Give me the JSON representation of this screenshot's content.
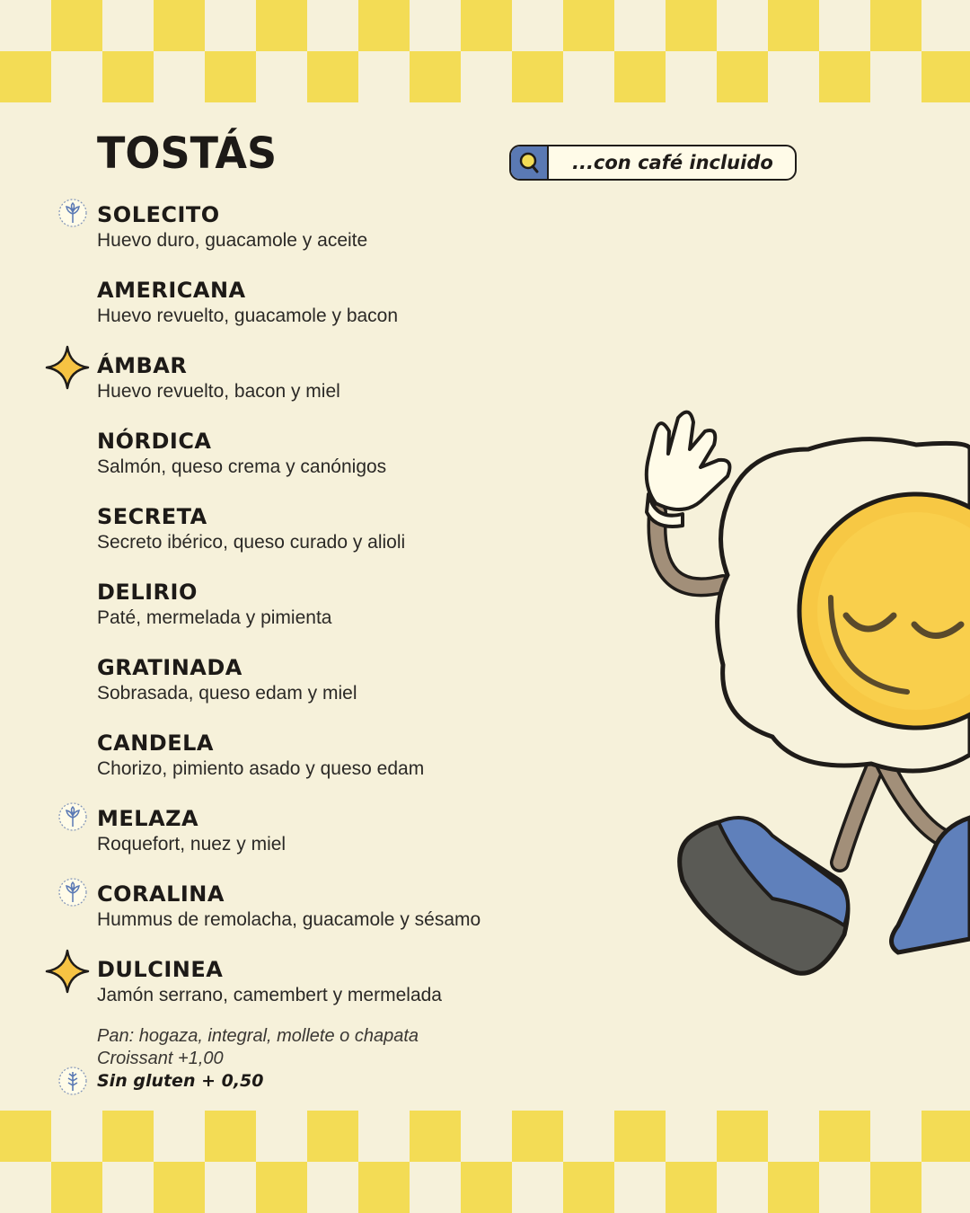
{
  "title": "TOSTÁS",
  "search": {
    "text": "...con café incluido",
    "icon": "magnifier-icon"
  },
  "items": [
    {
      "name": "SOLECITO",
      "desc": "Huevo duro, guacamole y aceite",
      "badge": "vegetarian-icon"
    },
    {
      "name": "AMERICANA",
      "desc": "Huevo revuelto, guacamole y bacon",
      "badge": ""
    },
    {
      "name": "ÁMBAR",
      "desc": "Huevo revuelto, bacon y miel",
      "badge": "star-icon"
    },
    {
      "name": "NÓRDICA",
      "desc": "Salmón, queso crema y canónigos",
      "badge": ""
    },
    {
      "name": "SECRETA",
      "desc": "Secreto ibérico, queso curado y alioli",
      "badge": ""
    },
    {
      "name": "DELIRIO",
      "desc": "Paté, mermelada y pimienta",
      "badge": ""
    },
    {
      "name": "GRATINADA",
      "desc": "Sobrasada, queso edam y miel",
      "badge": ""
    },
    {
      "name": "CANDELA",
      "desc": "Chorizo, pimiento asado y queso edam",
      "badge": ""
    },
    {
      "name": "MELAZA",
      "desc": "Roquefort, nuez y miel",
      "badge": "vegetarian-icon"
    },
    {
      "name": "CORALINA",
      "desc": "Hummus de remolacha, guacamole y sésamo",
      "badge": "vegetarian-icon"
    },
    {
      "name": "DULCINEA",
      "desc": "Jamón serrano, camembert y mermelada",
      "badge": "star-icon"
    }
  ],
  "notes": {
    "bread": "Pan: hogaza, integral, mollete o chapata",
    "croissant": "Croissant +1,00",
    "gluten_free": "Sin gluten + 0,50",
    "gluten_free_icon": "gluten-free-icon"
  },
  "colors": {
    "background": "#f6f1da",
    "checker": "#f3dc55",
    "star": "#f6c343",
    "search_icon_bg": "#5a79b4"
  }
}
